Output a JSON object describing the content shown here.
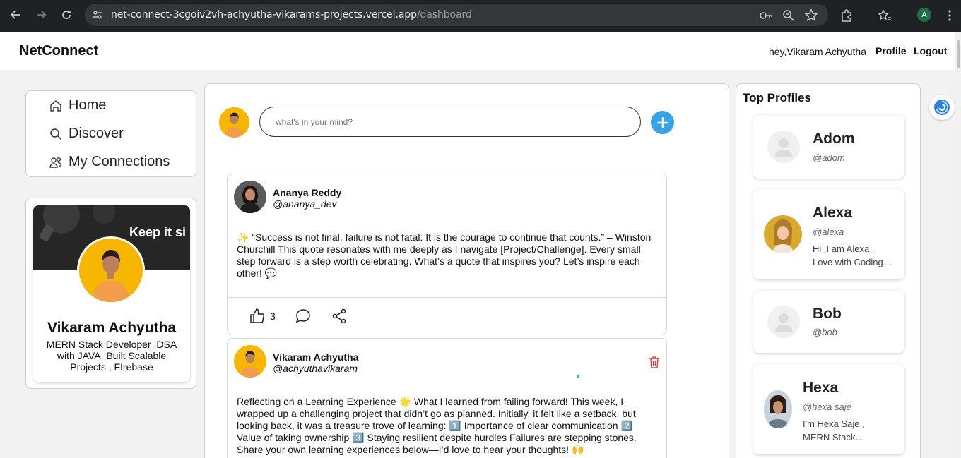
{
  "browser": {
    "url_host": "net-connect-3cgoiv2vh-achyutha-vikarams-projects.vercel.app",
    "url_path": "/dashboard",
    "account_initial": "A"
  },
  "header": {
    "brand": "NetConnect",
    "greeting": "hey,Vikaram Achyutha",
    "profile_link": "Profile",
    "logout_link": "Logout"
  },
  "sidebar": {
    "items": [
      {
        "label": "Home",
        "icon": "home-icon"
      },
      {
        "label": "Discover",
        "icon": "search-icon"
      },
      {
        "label": "My Connections",
        "icon": "users-icon"
      }
    ]
  },
  "profile": {
    "cover_text": "Keep it si",
    "name": "Vikaram Achyutha",
    "bio": "MERN Stack Developer ,DSA with JAVA, Built Scalable Projects , FIrebase"
  },
  "composer": {
    "placeholder": "what's in your mind?"
  },
  "posts": [
    {
      "author": "Ananya Reddy",
      "handle": "@ananya_dev",
      "body": "✨ “Success is not final, failure is not fatal: It is the courage to continue that counts.” – Winston Churchill This quote resonates with me deeply as I navigate [Project/Challenge]. Every small step forward is a step worth celebrating. What’s a quote that inspires you? Let’s inspire each other! 💬",
      "likes": "3"
    },
    {
      "author": "Vikaram Achyutha",
      "handle": "@achyuthavikaram",
      "body": "Reflecting on a Learning Experience 🌟 What I learned from failing forward! This week, I wrapped up a challenging project that didn’t go as planned. Initially, it felt like a setback, but looking back, it was a treasure trove of learning: 1️⃣ Importance of clear communication 2️⃣ Value of taking ownership 3️⃣ Staying resilient despite hurdles Failures are stepping stones. Share your own learning experiences below—I’d love to hear your thoughts! 🙌"
    }
  ],
  "top_profiles": {
    "title": "Top Profiles",
    "items": [
      {
        "name": "Adom",
        "handle": "@adom",
        "bio": ""
      },
      {
        "name": "Alexa",
        "handle": "@alexa",
        "bio": "Hi ,I am Alexa . Love with Coding…"
      },
      {
        "name": "Bob",
        "handle": "@bob",
        "bio": ""
      },
      {
        "name": "Hexa",
        "handle": "@hexa saje",
        "bio": "I'm Hexa Saje , MERN Stack…"
      }
    ]
  },
  "colors": {
    "accent": "#37a2e6",
    "delete": "#e53935",
    "avatar_bg": "#f7b600"
  }
}
